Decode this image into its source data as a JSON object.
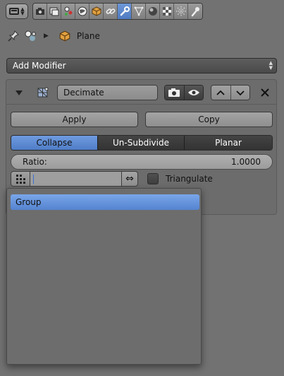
{
  "header": {
    "editor_type_icon": "properties-editor-icon",
    "context_tabs": [
      {
        "name": "tab-render",
        "icon": "render-camera-icon",
        "active": false
      },
      {
        "name": "tab-render-layers",
        "icon": "render-layers-icon",
        "active": false
      },
      {
        "name": "tab-scene",
        "icon": "scene-icon",
        "active": false
      },
      {
        "name": "tab-world",
        "icon": "world-icon",
        "active": false
      },
      {
        "name": "tab-object",
        "icon": "object-cube-icon",
        "active": false
      },
      {
        "name": "tab-constraints",
        "icon": "constraints-link-icon",
        "active": false
      },
      {
        "name": "tab-modifiers",
        "icon": "wrench-icon",
        "active": true
      },
      {
        "name": "tab-data",
        "icon": "mesh-data-icon",
        "active": false
      },
      {
        "name": "tab-material",
        "icon": "material-sphere-icon",
        "active": false
      },
      {
        "name": "tab-texture",
        "icon": "texture-checker-icon",
        "active": false
      },
      {
        "name": "tab-particles",
        "icon": "particles-icon",
        "active": false
      },
      {
        "name": "tab-physics",
        "icon": "physics-icon",
        "active": false
      }
    ],
    "accent_color": "#5b87d0"
  },
  "breadcrumb": {
    "object_label": "Plane"
  },
  "add_modifier_label": "Add Modifier",
  "modifier": {
    "name": "Decimate",
    "apply_label": "Apply",
    "copy_label": "Copy",
    "modes": [
      {
        "label": "Collapse",
        "active": true
      },
      {
        "label": "Un-Subdivide",
        "active": false
      },
      {
        "label": "Planar",
        "active": false
      }
    ],
    "ratio_label": "Ratio:",
    "ratio_value": "1.0000",
    "vertex_group_value": "",
    "triangulate_label": "Triangulate",
    "triangulate_checked": false
  },
  "dropdown": {
    "items": [
      "Group"
    ],
    "highlighted_index": 0
  }
}
